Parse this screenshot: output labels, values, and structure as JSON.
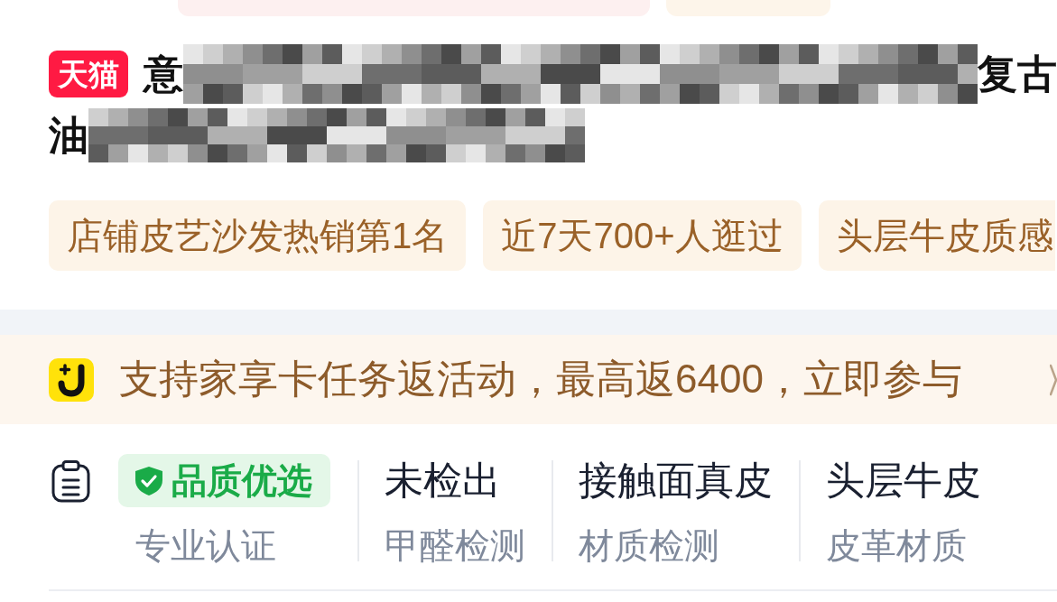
{
  "top_panels": [
    {
      "color": "#fdf0f0"
    },
    {
      "color": "#fdf5ea"
    }
  ],
  "product_title": {
    "badge": "天猫",
    "lines": [
      [
        {
          "kind": "text",
          "text": "意"
        },
        {
          "kind": "redacted"
        },
        {
          "kind": "text",
          "text": "复古"
        }
      ],
      [
        {
          "kind": "text",
          "text": "油"
        },
        {
          "kind": "redacted"
        }
      ]
    ]
  },
  "highlight_tags": [
    "店铺皮艺沙发热销第1名",
    "近7天700+人逛过",
    "头层牛皮质感"
  ],
  "promo_banner": {
    "text": "支持家享卡任务返活动，最高返6400，立即参与"
  },
  "attributes": [
    {
      "kind": "badge",
      "title": "品质优选",
      "label": "专业认证"
    },
    {
      "kind": "value",
      "title": "未检出",
      "label": "甲醛检测"
    },
    {
      "kind": "value",
      "title": "接触面真皮",
      "label": "材质检测"
    },
    {
      "kind": "value",
      "title": "头层牛皮",
      "label": "皮革材质"
    }
  ]
}
